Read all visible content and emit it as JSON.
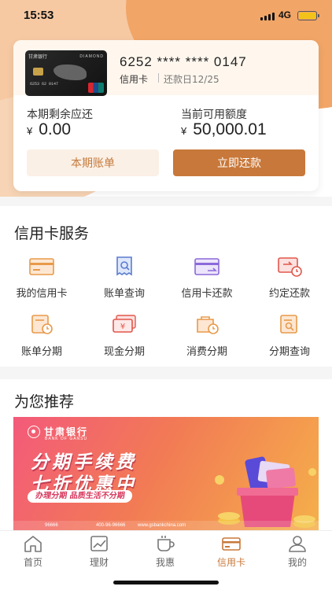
{
  "status_bar": {
    "time": "15:53",
    "network": "4G"
  },
  "card": {
    "masked_number": "6252 **** **** 0147",
    "type": "信用卡",
    "due_date": "还款日12/25",
    "thumbnail": {
      "bank_name": "甘肃银行",
      "tier": "DIAMOND",
      "number": "6253 62 0147"
    }
  },
  "summary": {
    "remaining_label": "本期剩余应还",
    "remaining_value": "0.00",
    "available_label": "当前可用额度",
    "available_value": "50,000.01",
    "currency_symbol": "¥"
  },
  "actions": {
    "statement_label": "本期账单",
    "repay_label": "立即还款"
  },
  "services": {
    "title": "信用卡服务",
    "items": [
      {
        "label": "我的信用卡",
        "icon": "credit-card-icon"
      },
      {
        "label": "账单查询",
        "icon": "bill-search-icon"
      },
      {
        "label": "信用卡还款",
        "icon": "card-repay-icon"
      },
      {
        "label": "约定还款",
        "icon": "scheduled-repay-icon"
      },
      {
        "label": "账单分期",
        "icon": "bill-installment-icon"
      },
      {
        "label": "现金分期",
        "icon": "cash-installment-icon"
      },
      {
        "label": "消费分期",
        "icon": "consumption-installment-icon"
      },
      {
        "label": "分期查询",
        "icon": "installment-search-icon"
      }
    ]
  },
  "recommend": {
    "title": "为您推荐",
    "banner": {
      "bank_name": "甘肃银行",
      "bank_name_en": "BANK OF GANSU",
      "headline_1": "分期手续费",
      "headline_2": "七折优惠中",
      "tagline": "办理分期  品质生活不分期",
      "footer_1": "96666",
      "footer_2": "400-96-96666",
      "footer_3": "www.gsbankchina.com"
    }
  },
  "tabbar": {
    "items": [
      {
        "label": "首页",
        "icon": "home-icon",
        "active": false
      },
      {
        "label": "理财",
        "icon": "chart-icon",
        "active": false
      },
      {
        "label": "我惠",
        "icon": "coffee-icon",
        "active": false
      },
      {
        "label": "信用卡",
        "icon": "credit-card-icon",
        "active": true
      },
      {
        "label": "我的",
        "icon": "user-icon",
        "active": false
      }
    ]
  },
  "colors": {
    "accent": "#c8783a",
    "accent_light": "#fbf0e6",
    "icon_red": "#e2574c",
    "icon_blue": "#5b7ccf",
    "icon_purple": "#8b6ad9",
    "icon_orange": "#e89a4a"
  }
}
